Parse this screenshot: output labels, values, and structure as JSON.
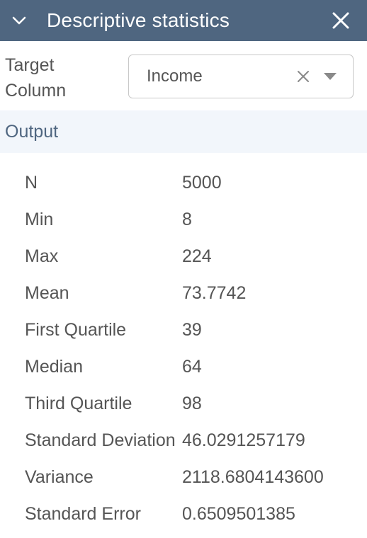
{
  "header": {
    "title": "Descriptive statistics",
    "background": "#4f6680"
  },
  "target": {
    "label_line1": "Target",
    "label_line2": "Column",
    "selected_value": "Income"
  },
  "output": {
    "title": "Output",
    "band_color": "#f2f6fb"
  },
  "stats": [
    {
      "name": "N",
      "value": "5000"
    },
    {
      "name": "Min",
      "value": "8"
    },
    {
      "name": "Max",
      "value": "224"
    },
    {
      "name": "Mean",
      "value": "73.7742"
    },
    {
      "name": "First Quartile",
      "value": "39"
    },
    {
      "name": "Median",
      "value": "64"
    },
    {
      "name": "Third Quartile",
      "value": "98"
    },
    {
      "name": "Standard Deviation",
      "value": "46.0291257179"
    },
    {
      "name": "Variance",
      "value": "2118.6804143600"
    },
    {
      "name": "Standard Error",
      "value": "0.6509501385"
    }
  ]
}
